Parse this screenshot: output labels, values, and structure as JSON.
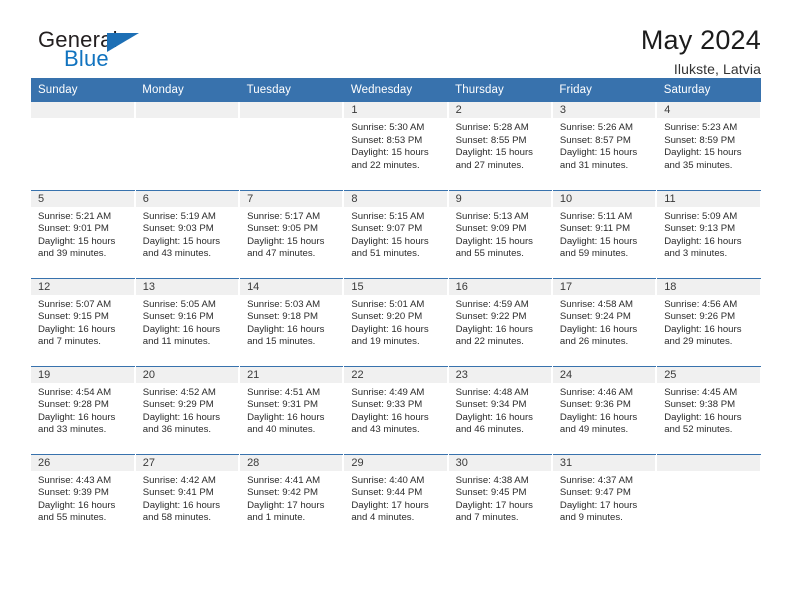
{
  "brand": {
    "word_top": "General",
    "word_bottom": "Blue",
    "triangle_color": "#1d6fb5",
    "text_color": "#231f20",
    "blue_color": "#1173bf"
  },
  "header": {
    "title": "May 2024",
    "subtitle": "Ilukste, Latvia",
    "accent_color": "#3872ad",
    "band_color": "#f0f0f0"
  },
  "weekday_headers": [
    "Sunday",
    "Monday",
    "Tuesday",
    "Wednesday",
    "Thursday",
    "Friday",
    "Saturday"
  ],
  "labels": {
    "sunrise": "Sunrise:",
    "sunset": "Sunset:",
    "daylight": "Daylight:"
  },
  "weeks": [
    [
      {
        "day": ""
      },
      {
        "day": ""
      },
      {
        "day": ""
      },
      {
        "day": "1",
        "line1": "Sunrise: 5:30 AM",
        "line2": "Sunset: 8:53 PM",
        "line3": "Daylight: 15 hours",
        "line4": "and 22 minutes."
      },
      {
        "day": "2",
        "line1": "Sunrise: 5:28 AM",
        "line2": "Sunset: 8:55 PM",
        "line3": "Daylight: 15 hours",
        "line4": "and 27 minutes."
      },
      {
        "day": "3",
        "line1": "Sunrise: 5:26 AM",
        "line2": "Sunset: 8:57 PM",
        "line3": "Daylight: 15 hours",
        "line4": "and 31 minutes."
      },
      {
        "day": "4",
        "line1": "Sunrise: 5:23 AM",
        "line2": "Sunset: 8:59 PM",
        "line3": "Daylight: 15 hours",
        "line4": "and 35 minutes."
      }
    ],
    [
      {
        "day": "5",
        "line1": "Sunrise: 5:21 AM",
        "line2": "Sunset: 9:01 PM",
        "line3": "Daylight: 15 hours",
        "line4": "and 39 minutes."
      },
      {
        "day": "6",
        "line1": "Sunrise: 5:19 AM",
        "line2": "Sunset: 9:03 PM",
        "line3": "Daylight: 15 hours",
        "line4": "and 43 minutes."
      },
      {
        "day": "7",
        "line1": "Sunrise: 5:17 AM",
        "line2": "Sunset: 9:05 PM",
        "line3": "Daylight: 15 hours",
        "line4": "and 47 minutes."
      },
      {
        "day": "8",
        "line1": "Sunrise: 5:15 AM",
        "line2": "Sunset: 9:07 PM",
        "line3": "Daylight: 15 hours",
        "line4": "and 51 minutes."
      },
      {
        "day": "9",
        "line1": "Sunrise: 5:13 AM",
        "line2": "Sunset: 9:09 PM",
        "line3": "Daylight: 15 hours",
        "line4": "and 55 minutes."
      },
      {
        "day": "10",
        "line1": "Sunrise: 5:11 AM",
        "line2": "Sunset: 9:11 PM",
        "line3": "Daylight: 15 hours",
        "line4": "and 59 minutes."
      },
      {
        "day": "11",
        "line1": "Sunrise: 5:09 AM",
        "line2": "Sunset: 9:13 PM",
        "line3": "Daylight: 16 hours",
        "line4": "and 3 minutes."
      }
    ],
    [
      {
        "day": "12",
        "line1": "Sunrise: 5:07 AM",
        "line2": "Sunset: 9:15 PM",
        "line3": "Daylight: 16 hours",
        "line4": "and 7 minutes."
      },
      {
        "day": "13",
        "line1": "Sunrise: 5:05 AM",
        "line2": "Sunset: 9:16 PM",
        "line3": "Daylight: 16 hours",
        "line4": "and 11 minutes."
      },
      {
        "day": "14",
        "line1": "Sunrise: 5:03 AM",
        "line2": "Sunset: 9:18 PM",
        "line3": "Daylight: 16 hours",
        "line4": "and 15 minutes."
      },
      {
        "day": "15",
        "line1": "Sunrise: 5:01 AM",
        "line2": "Sunset: 9:20 PM",
        "line3": "Daylight: 16 hours",
        "line4": "and 19 minutes."
      },
      {
        "day": "16",
        "line1": "Sunrise: 4:59 AM",
        "line2": "Sunset: 9:22 PM",
        "line3": "Daylight: 16 hours",
        "line4": "and 22 minutes."
      },
      {
        "day": "17",
        "line1": "Sunrise: 4:58 AM",
        "line2": "Sunset: 9:24 PM",
        "line3": "Daylight: 16 hours",
        "line4": "and 26 minutes."
      },
      {
        "day": "18",
        "line1": "Sunrise: 4:56 AM",
        "line2": "Sunset: 9:26 PM",
        "line3": "Daylight: 16 hours",
        "line4": "and 29 minutes."
      }
    ],
    [
      {
        "day": "19",
        "line1": "Sunrise: 4:54 AM",
        "line2": "Sunset: 9:28 PM",
        "line3": "Daylight: 16 hours",
        "line4": "and 33 minutes."
      },
      {
        "day": "20",
        "line1": "Sunrise: 4:52 AM",
        "line2": "Sunset: 9:29 PM",
        "line3": "Daylight: 16 hours",
        "line4": "and 36 minutes."
      },
      {
        "day": "21",
        "line1": "Sunrise: 4:51 AM",
        "line2": "Sunset: 9:31 PM",
        "line3": "Daylight: 16 hours",
        "line4": "and 40 minutes."
      },
      {
        "day": "22",
        "line1": "Sunrise: 4:49 AM",
        "line2": "Sunset: 9:33 PM",
        "line3": "Daylight: 16 hours",
        "line4": "and 43 minutes."
      },
      {
        "day": "23",
        "line1": "Sunrise: 4:48 AM",
        "line2": "Sunset: 9:34 PM",
        "line3": "Daylight: 16 hours",
        "line4": "and 46 minutes."
      },
      {
        "day": "24",
        "line1": "Sunrise: 4:46 AM",
        "line2": "Sunset: 9:36 PM",
        "line3": "Daylight: 16 hours",
        "line4": "and 49 minutes."
      },
      {
        "day": "25",
        "line1": "Sunrise: 4:45 AM",
        "line2": "Sunset: 9:38 PM",
        "line3": "Daylight: 16 hours",
        "line4": "and 52 minutes."
      }
    ],
    [
      {
        "day": "26",
        "line1": "Sunrise: 4:43 AM",
        "line2": "Sunset: 9:39 PM",
        "line3": "Daylight: 16 hours",
        "line4": "and 55 minutes."
      },
      {
        "day": "27",
        "line1": "Sunrise: 4:42 AM",
        "line2": "Sunset: 9:41 PM",
        "line3": "Daylight: 16 hours",
        "line4": "and 58 minutes."
      },
      {
        "day": "28",
        "line1": "Sunrise: 4:41 AM",
        "line2": "Sunset: 9:42 PM",
        "line3": "Daylight: 17 hours",
        "line4": "and 1 minute."
      },
      {
        "day": "29",
        "line1": "Sunrise: 4:40 AM",
        "line2": "Sunset: 9:44 PM",
        "line3": "Daylight: 17 hours",
        "line4": "and 4 minutes."
      },
      {
        "day": "30",
        "line1": "Sunrise: 4:38 AM",
        "line2": "Sunset: 9:45 PM",
        "line3": "Daylight: 17 hours",
        "line4": "and 7 minutes."
      },
      {
        "day": "31",
        "line1": "Sunrise: 4:37 AM",
        "line2": "Sunset: 9:47 PM",
        "line3": "Daylight: 17 hours",
        "line4": "and 9 minutes."
      },
      {
        "day": ""
      }
    ]
  ]
}
